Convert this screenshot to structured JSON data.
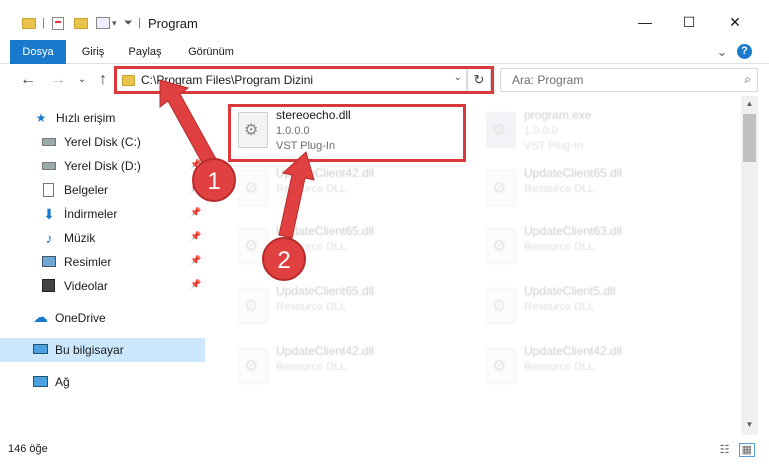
{
  "window": {
    "title": "Program",
    "minimize": "—",
    "maximize": "☐",
    "close": "✕"
  },
  "ribbon": {
    "tabs": [
      {
        "label": "Dosya"
      },
      {
        "label": "Giriş"
      },
      {
        "label": "Paylaş"
      },
      {
        "label": "Görünüm"
      }
    ],
    "expand": "⌄",
    "help": "?"
  },
  "nav": {
    "back": "←",
    "forward": "→",
    "recent": "⌄",
    "up": "↑",
    "address": "C:\\Program Files\\Program Dizini",
    "address_dropdown": "⌄",
    "refresh": "↻",
    "search_placeholder": "Ara: Program",
    "search_icon": "⌕"
  },
  "sidebar": {
    "items": [
      {
        "label": "Hızlı erişim",
        "icon": "star-icon"
      },
      {
        "label": "Yerel Disk (C:)",
        "icon": "drive-icon"
      },
      {
        "label": "Yerel Disk (D:)",
        "icon": "drive-icon"
      },
      {
        "label": "Belgeler",
        "icon": "document-icon"
      },
      {
        "label": "İndirmeler",
        "icon": "download-icon"
      },
      {
        "label": "Müzik",
        "icon": "music-icon"
      },
      {
        "label": "Resimler",
        "icon": "pictures-icon"
      },
      {
        "label": "Videolar",
        "icon": "video-icon"
      },
      {
        "label": "OneDrive",
        "icon": "cloud-icon"
      },
      {
        "label": "Bu bilgisayar",
        "icon": "computer-icon"
      },
      {
        "label": "Ağ",
        "icon": "network-icon"
      }
    ]
  },
  "files": [
    {
      "name": "stereoecho.dll",
      "line2": "1.0.0.0",
      "line3": "VST Plug-In"
    },
    {
      "name": "program.exe",
      "line2": "1.0.0.0",
      "line3": "VST Plug-In"
    },
    {
      "name": "UpdateClient42.dll",
      "line2": "Resource DLL"
    },
    {
      "name": "UpdateClient65.dll",
      "line2": "Resource DLL"
    },
    {
      "name": "UpdateClient65.dll",
      "line2": "Resource DLL"
    },
    {
      "name": "UpdateClient63.dll",
      "line2": "Resource DLL"
    },
    {
      "name": "UpdateClient65.dll",
      "line2": "Resource DLL"
    },
    {
      "name": "UpdateClient5.dll",
      "line2": "Resource DLL"
    },
    {
      "name": "UpdateClient42.dll",
      "line2": "Resource DLL"
    },
    {
      "name": "UpdateClient42.dll",
      "line2": "Resource DLL"
    }
  ],
  "status": {
    "count": "146 öğe"
  },
  "annotations": {
    "badge1": "1",
    "badge2": "2"
  },
  "colors": {
    "accent": "#1979ca",
    "highlight": "#d9393c",
    "selected": "#cce8ff"
  }
}
